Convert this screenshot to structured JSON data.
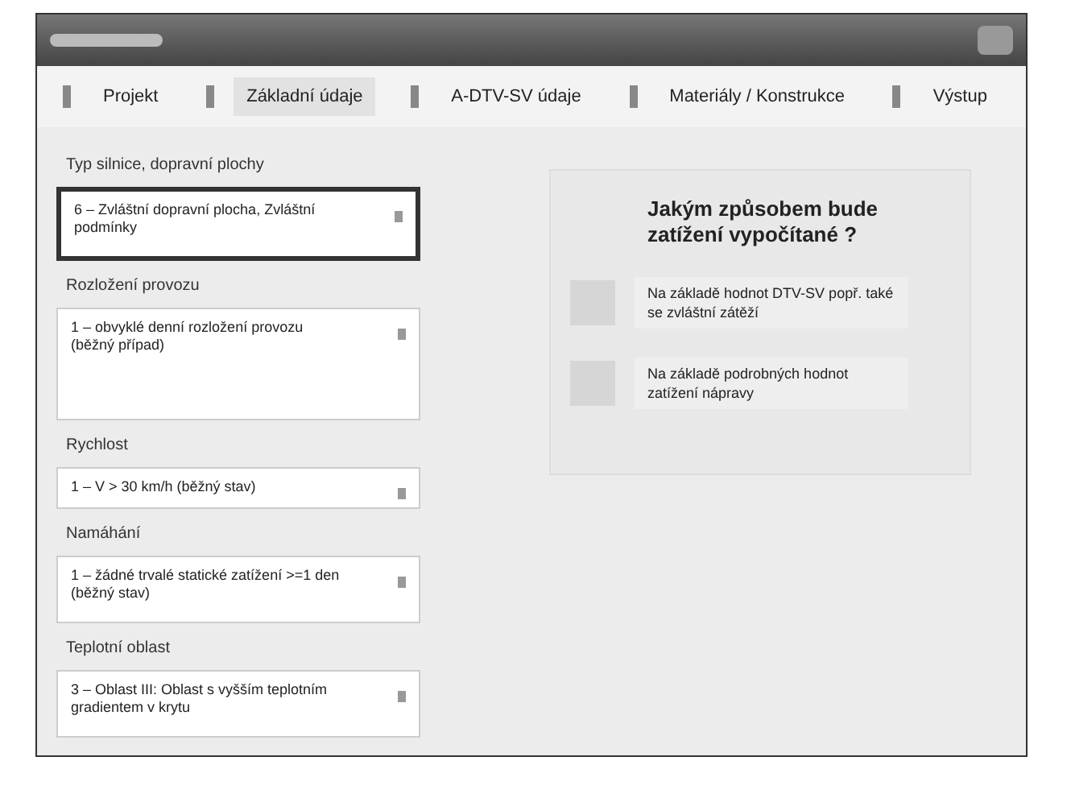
{
  "tabs": [
    {
      "label": "Projekt",
      "selected": false
    },
    {
      "label": "Základní údaje",
      "selected": true
    },
    {
      "label": "A-DTV-SV údaje",
      "selected": false
    },
    {
      "label": "Materiály / Konstrukce",
      "selected": false
    },
    {
      "label": "Výstup",
      "selected": false
    }
  ],
  "fields": [
    {
      "label": "Typ silnice, dopravní plochy",
      "value": "6 – Zvláštní dopravní plocha, Zvláštní podmínky",
      "selected": true
    },
    {
      "label": "Rozložení provozu",
      "value": "1 – obvyklé denní rozložení provozu (běžný případ)",
      "selected": false
    },
    {
      "label": "Rychlost",
      "value": "1 – V > 30 km/h (běžný stav)",
      "selected": false
    },
    {
      "label": "Namáhání",
      "value": "1 – žádné trvalé statické zatížení >=1 den (běžný stav)",
      "selected": false
    },
    {
      "label": "Teplotní oblast",
      "value": "3 – Oblast III: Oblast s vyšším teplotním gradientem v krytu",
      "selected": false
    }
  ],
  "question": {
    "title": "Jakým způsobem bude zatížení vypočítané ?",
    "options": [
      {
        "label": "Na základě hodnot DTV-SV popř. také se zvláštní zátěží"
      },
      {
        "label": "Na základě podrobných hodnot zatížení nápravy"
      }
    ]
  }
}
